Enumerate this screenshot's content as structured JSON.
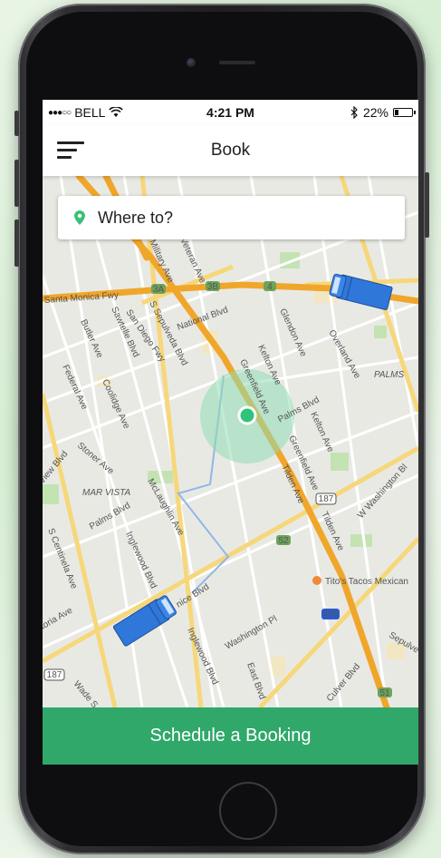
{
  "status_bar": {
    "signal_dots": "●●●○○",
    "carrier": "BELL",
    "time": "4:21 PM",
    "bluetooth_icon": "bluetooth-icon",
    "battery_percent": "22%",
    "battery_level": 0.22
  },
  "nav": {
    "title": "Book",
    "menu_icon": "hamburger-menu-icon"
  },
  "search": {
    "placeholder": "Where to?",
    "icon": "location-pin-icon",
    "pin_color": "#3cc078"
  },
  "map": {
    "labels": {
      "santa_monica_fwy": "Santa Monica Fwy",
      "san_diego_fwy": "San Diego Fwy",
      "s_sepulveda": "S Sepulveda Blvd",
      "national": "National Blvd",
      "sawtelle": "Sawtelle Blvd",
      "butler": "Butler Ave",
      "federal": "Federal Ave",
      "coolidge": "Coolidge Ave",
      "stoner": "Stoner Ave",
      "mar_vista": "MAR VISTA",
      "palms_blvd": "Palms Blvd",
      "palms_blvd_2": "Palms Blvd",
      "palms": "PALMS",
      "overland": "Overland Ave",
      "glendon": "Glendon Ave",
      "kelton": "Kelton Ave",
      "greenfield": "Greenfield Ave",
      "tilden": "Tilden Ave",
      "w_washington": "W Washington Bl",
      "mclaughlin": "McLaughlin Ave",
      "inglewood": "Inglewood Blvd",
      "inglewood_2": "Inglewood Blvd",
      "centinela": "S Centinela Ave",
      "washington_pl": "Washington Pl",
      "east_blvd": "East Blvd",
      "culver": "Culver Blvd",
      "venice": "nice Blvd",
      "titos": "Tito's Tacos Mexican",
      "view": "View Blvd",
      "sepulveda_short": "Sepulve",
      "toria": "toria Ave",
      "wade": "Wade S",
      "shield_187a": "187",
      "shield_187b": "187",
      "shield_405": "405",
      "shield_4": "4",
      "shield_3a": "3A",
      "shield_3b": "3B",
      "shield_52": "52",
      "shield_51": "51",
      "military": "Military Ave",
      "veteran": "Veteran Ave"
    },
    "colors": {
      "freeway": "#f0a62b",
      "arterial": "#f6d77a",
      "park": "#c4e3b3",
      "radius": "#8fdcb3",
      "user_dot": "#2fc47a",
      "truck": "#2f77d8"
    },
    "vehicles": [
      "truck-icon",
      "truck-icon"
    ]
  },
  "footer": {
    "button_label": "Schedule a Booking",
    "button_color": "#2fa86a"
  }
}
